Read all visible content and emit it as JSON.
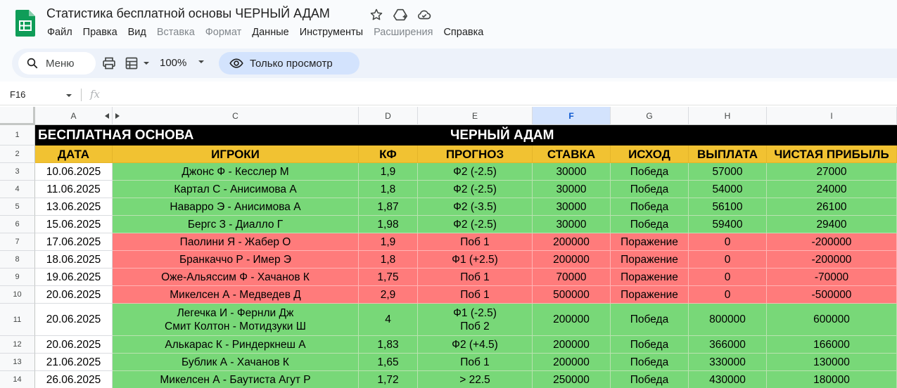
{
  "header": {
    "title": "Статистика бесплатной основы ЧЕРНЫЙ АДАМ",
    "menu": [
      {
        "label": "Файл",
        "disabled": false
      },
      {
        "label": "Правка",
        "disabled": false
      },
      {
        "label": "Вид",
        "disabled": false
      },
      {
        "label": "Вставка",
        "disabled": true
      },
      {
        "label": "Формат",
        "disabled": true
      },
      {
        "label": "Данные",
        "disabled": false
      },
      {
        "label": "Инструменты",
        "disabled": false
      },
      {
        "label": "Расширения",
        "disabled": true
      },
      {
        "label": "Справка",
        "disabled": false
      }
    ]
  },
  "toolbar": {
    "search_label": "Меню",
    "zoom": "100%",
    "view_mode": "Только просмотр"
  },
  "formula_bar": {
    "cell_ref": "F16",
    "fx": "fx"
  },
  "colors": {
    "header_bg": "#f1c232",
    "win_bg": "#78d878",
    "loss_bg": "#ff7b7b",
    "title_bg": "#000000"
  },
  "sheet": {
    "col_letters": [
      "A",
      "C",
      "D",
      "E",
      "F",
      "G",
      "H",
      "I"
    ],
    "selected_col": "F",
    "row_numbers": [
      "1",
      "2",
      "3",
      "4",
      "5",
      "6",
      "7",
      "8",
      "9",
      "10",
      "11",
      "12",
      "13",
      "14"
    ],
    "banner_left": "БЕСПЛАТНАЯ ОСНОВА",
    "banner_center": "ЧЕРНЫЙ АДАМ",
    "headers": [
      "ДАТА",
      "ИГРОКИ",
      "КФ",
      "ПРОГНОЗ",
      "СТАВКА",
      "ИСХОД",
      "ВЫПЛАТА",
      "ЧИСТАЯ ПРИБЫЛЬ"
    ],
    "rows": [
      {
        "date": "10.06.2025",
        "players": [
          "Джонс Ф - Кесслер М"
        ],
        "kf": "1,9",
        "forecast": [
          "Ф2 (-2.5)"
        ],
        "stake": "30000",
        "result": "Победа",
        "payout": "57000",
        "profit": "27000",
        "status": "win"
      },
      {
        "date": "11.06.2025",
        "players": [
          "Картал С - Анисимова А"
        ],
        "kf": "1,8",
        "forecast": [
          "Ф2 (-2.5)"
        ],
        "stake": "30000",
        "result": "Победа",
        "payout": "54000",
        "profit": "24000",
        "status": "win"
      },
      {
        "date": "13.06.2025",
        "players": [
          "Наварро Э - Анисимова А"
        ],
        "kf": "1,87",
        "forecast": [
          "Ф2 (-3.5)"
        ],
        "stake": "30000",
        "result": "Победа",
        "payout": "56100",
        "profit": "26100",
        "status": "win"
      },
      {
        "date": "15.06.2025",
        "players": [
          "Бергс З - Диалло Г"
        ],
        "kf": "1,98",
        "forecast": [
          "Ф2 (-2.5)"
        ],
        "stake": "30000",
        "result": "Победа",
        "payout": "59400",
        "profit": "29400",
        "status": "win"
      },
      {
        "date": "17.06.2025",
        "players": [
          "Паолини Я - Жабер О"
        ],
        "kf": "1,9",
        "forecast": [
          "Поб 1"
        ],
        "stake": "200000",
        "result": "Поражение",
        "payout": "0",
        "profit": "-200000",
        "status": "loss"
      },
      {
        "date": "18.06.2025",
        "players": [
          "Бранкаччо Р - Имер Э"
        ],
        "kf": "1,8",
        "forecast": [
          "Ф1 (+2.5)"
        ],
        "stake": "200000",
        "result": "Поражение",
        "payout": "0",
        "profit": "-200000",
        "status": "loss"
      },
      {
        "date": "19.06.2025",
        "players": [
          "Оже-Альяссим Ф - Хачанов К"
        ],
        "kf": "1,75",
        "forecast": [
          "Поб 1"
        ],
        "stake": "70000",
        "result": "Поражение",
        "payout": "0",
        "profit": "-70000",
        "status": "loss"
      },
      {
        "date": "20.06.2025",
        "players": [
          "Микелсен А - Медведев Д"
        ],
        "kf": "2,9",
        "forecast": [
          "Поб 1"
        ],
        "stake": "500000",
        "result": "Поражение",
        "payout": "0",
        "profit": "-500000",
        "status": "loss"
      },
      {
        "date": "20.06.2025",
        "players": [
          "Легечка И - Фернли Дж",
          "Смит Колтон - Мотидзуки Ш"
        ],
        "kf": "4",
        "forecast": [
          "Ф1 (-2.5)",
          "Поб 2"
        ],
        "stake": "200000",
        "result": "Победа",
        "payout": "800000",
        "profit": "600000",
        "status": "win"
      },
      {
        "date": "20.06.2025",
        "players": [
          "Алькарас К - Риндеркнеш А"
        ],
        "kf": "1,83",
        "forecast": [
          "Ф2 (+4.5)"
        ],
        "stake": "200000",
        "result": "Победа",
        "payout": "366000",
        "profit": "166000",
        "status": "win"
      },
      {
        "date": "21.06.2025",
        "players": [
          "Бублик А - Хачанов К"
        ],
        "kf": "1,65",
        "forecast": [
          "Поб 1"
        ],
        "stake": "200000",
        "result": "Победа",
        "payout": "330000",
        "profit": "130000",
        "status": "win"
      },
      {
        "date": "26.06.2025",
        "players": [
          "Микелсен А - Баутиста Агут Р"
        ],
        "kf": "1,72",
        "forecast": [
          "> 22.5"
        ],
        "stake": "250000",
        "result": "Победа",
        "payout": "430000",
        "profit": "180000",
        "status": "win"
      }
    ]
  }
}
